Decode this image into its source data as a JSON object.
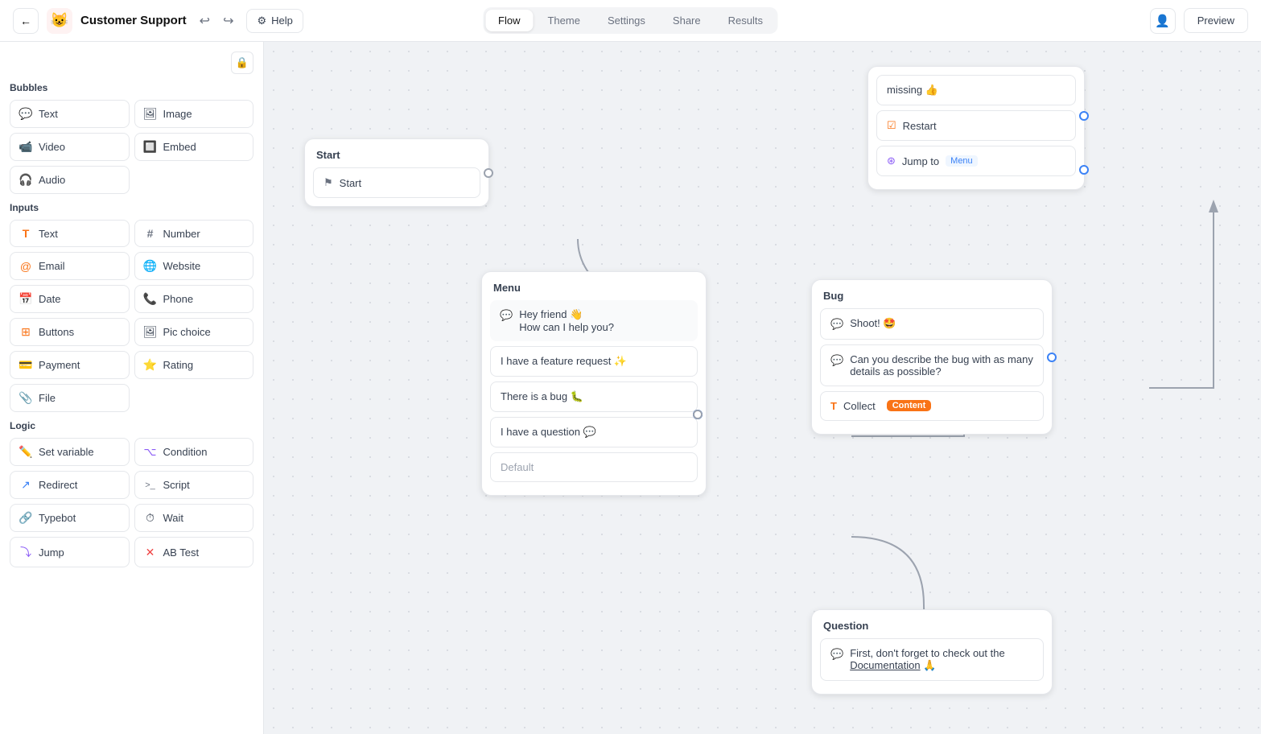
{
  "app": {
    "name": "Customer Support",
    "icon": "😺"
  },
  "topnav": {
    "back_icon": "←",
    "undo_icon": "↩",
    "redo_icon": "↪",
    "help_label": "Help",
    "tabs": [
      "Flow",
      "Theme",
      "Settings",
      "Share",
      "Results"
    ],
    "active_tab": "Flow",
    "preview_label": "Preview",
    "person_icon": "👤"
  },
  "sidebar": {
    "lock_icon": "🔒",
    "sections": {
      "bubbles": {
        "title": "Bubbles",
        "items": [
          {
            "id": "text-bubble",
            "icon": "💬",
            "label": "Text"
          },
          {
            "id": "image-bubble",
            "icon": "🖼",
            "label": "Image"
          },
          {
            "id": "video-bubble",
            "icon": "📹",
            "label": "Video"
          },
          {
            "id": "embed-bubble",
            "icon": "🔲",
            "label": "Embed"
          },
          {
            "id": "audio-bubble",
            "icon": "🎧",
            "label": "Audio"
          }
        ]
      },
      "inputs": {
        "title": "Inputs",
        "items": [
          {
            "id": "text-input",
            "icon": "T",
            "label": "Text",
            "icon_type": "text"
          },
          {
            "id": "number-input",
            "icon": "#",
            "label": "Number",
            "icon_type": "text"
          },
          {
            "id": "email-input",
            "icon": "@",
            "label": "Email"
          },
          {
            "id": "website-input",
            "icon": "🌐",
            "label": "Website"
          },
          {
            "id": "date-input",
            "icon": "📅",
            "label": "Date"
          },
          {
            "id": "phone-input",
            "icon": "📞",
            "label": "Phone"
          },
          {
            "id": "buttons-input",
            "icon": "⊞",
            "label": "Buttons"
          },
          {
            "id": "picchoice-input",
            "icon": "🖼",
            "label": "Pic choice"
          },
          {
            "id": "payment-input",
            "icon": "💳",
            "label": "Payment"
          },
          {
            "id": "rating-input",
            "icon": "⭐",
            "label": "Rating"
          },
          {
            "id": "file-input",
            "icon": "📎",
            "label": "File"
          }
        ]
      },
      "logic": {
        "title": "Logic",
        "items": [
          {
            "id": "setvariable-logic",
            "icon": "✏️",
            "label": "Set variable"
          },
          {
            "id": "condition-logic",
            "icon": "⌥",
            "label": "Condition"
          },
          {
            "id": "redirect-logic",
            "icon": "↗",
            "label": "Redirect"
          },
          {
            "id": "script-logic",
            "icon": ">_",
            "label": "Script"
          },
          {
            "id": "typebot-logic",
            "icon": "🔗",
            "label": "Typebot"
          },
          {
            "id": "wait-logic",
            "icon": "⏱",
            "label": "Wait"
          },
          {
            "id": "jump-logic",
            "icon": "⤵",
            "label": "Jump"
          },
          {
            "id": "abtest-logic",
            "icon": "✕",
            "label": "AB Test"
          }
        ]
      }
    }
  },
  "canvas": {
    "nodes": {
      "start": {
        "title": "Start",
        "label": "Start",
        "icon": "⚑"
      },
      "menu": {
        "title": "Menu",
        "bubble": "Hey friend 👋\nHow can I help you?",
        "choices": [
          {
            "text": "I have a feature request ✨"
          },
          {
            "text": "There is a bug 🐛"
          },
          {
            "text": "I have a question 💬"
          },
          {
            "text": "Default"
          }
        ]
      },
      "bug": {
        "title": "Bug",
        "items": [
          {
            "type": "bubble",
            "text": "Shoot! 🤩"
          },
          {
            "type": "bubble",
            "text": "Can you describe the bug with as many details as possible?"
          },
          {
            "type": "collect",
            "label": "Collect",
            "badge": "Content"
          }
        ]
      },
      "question": {
        "title": "Question",
        "items": [
          {
            "type": "bubble",
            "text": "First, don't forget to check out the Documentation 🙏"
          }
        ]
      }
    },
    "right_panel": {
      "items": [
        {
          "type": "text",
          "text": "missing 👍"
        },
        {
          "type": "restart",
          "text": "Restart"
        },
        {
          "type": "jump",
          "text": "Jump to",
          "target": "Menu"
        }
      ]
    }
  }
}
